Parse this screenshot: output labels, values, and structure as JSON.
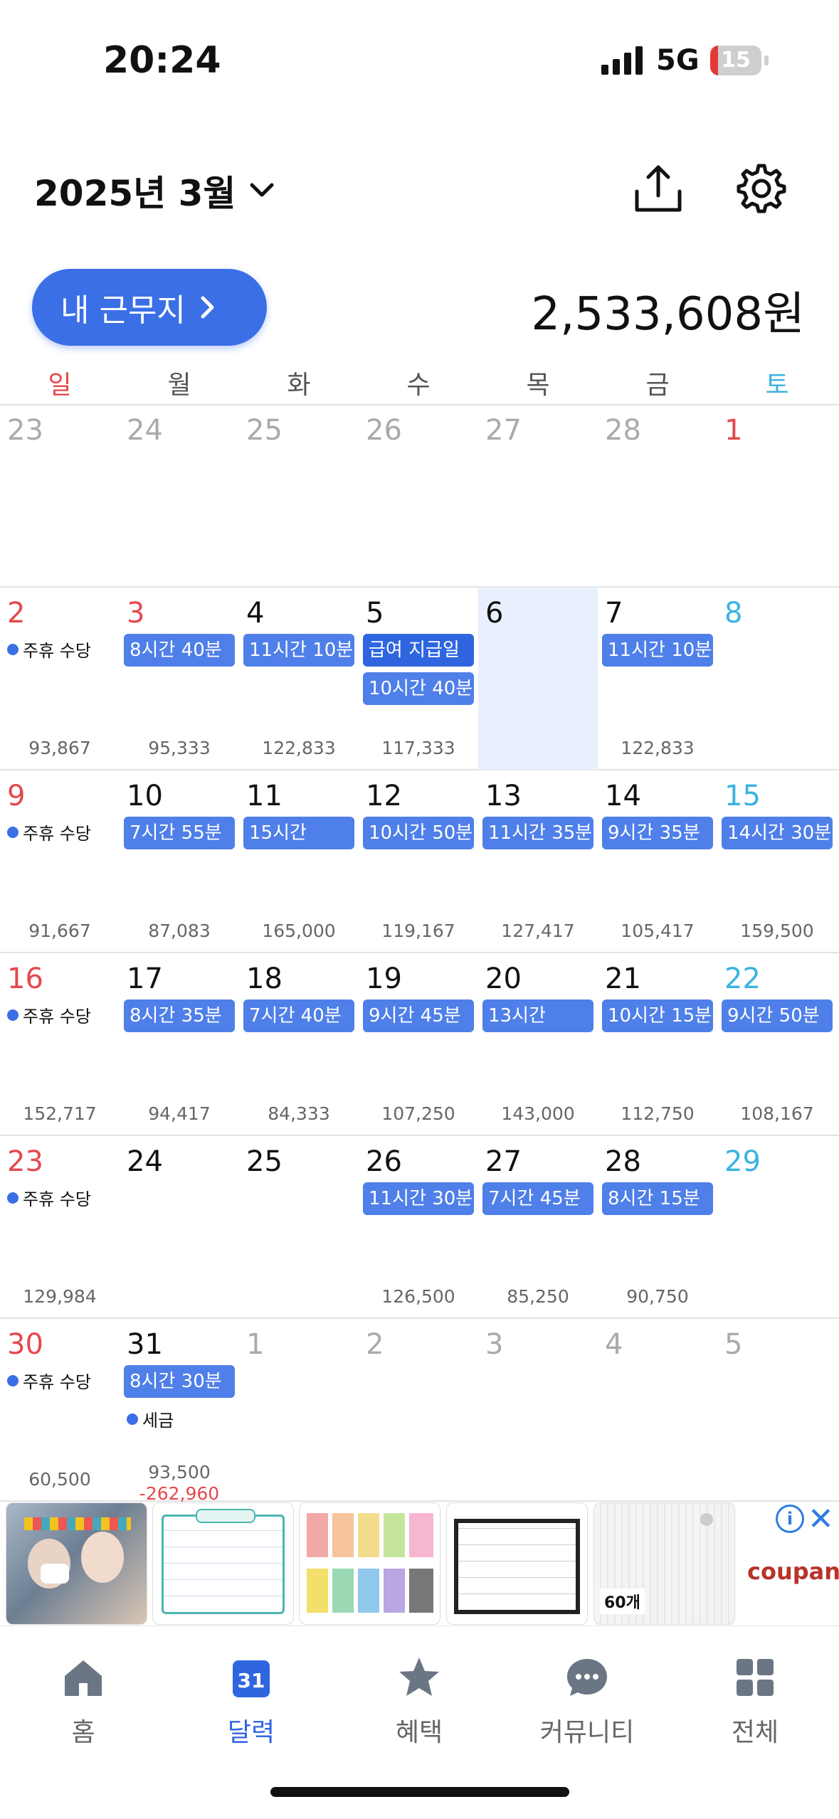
{
  "status_bar": {
    "time": "20:24",
    "network": "5G",
    "battery": "15",
    "battery_level": 0.15
  },
  "header": {
    "month_title": "2025년 3월"
  },
  "workplace": {
    "button_label": "내 근무지",
    "total_amount": "2,533,608원"
  },
  "weekdays": [
    "일",
    "월",
    "화",
    "수",
    "목",
    "금",
    "토"
  ],
  "weeks": [
    [
      {
        "day": "23",
        "kind": "other"
      },
      {
        "day": "24",
        "kind": "other"
      },
      {
        "day": "25",
        "kind": "other"
      },
      {
        "day": "26",
        "kind": "other"
      },
      {
        "day": "27",
        "kind": "other"
      },
      {
        "day": "28",
        "kind": "other"
      },
      {
        "day": "1",
        "kind": "sun"
      }
    ],
    [
      {
        "day": "2",
        "kind": "sun",
        "note": "주휴 수당",
        "amount": "93,867"
      },
      {
        "day": "3",
        "kind": "sun",
        "chips": [
          "8시간 40분"
        ],
        "amount": "95,333"
      },
      {
        "day": "4",
        "chips": [
          "11시간 10분"
        ],
        "amount": "122,833"
      },
      {
        "day": "5",
        "chips": [
          "급여 지급일",
          "10시간 40분"
        ],
        "amount": "117,333"
      },
      {
        "day": "6",
        "today": true
      },
      {
        "day": "7",
        "chips": [
          "11시간 10분"
        ],
        "amount": "122,833"
      },
      {
        "day": "8",
        "kind": "sat"
      }
    ],
    [
      {
        "day": "9",
        "kind": "sun",
        "note": "주휴 수당",
        "amount": "91,667"
      },
      {
        "day": "10",
        "chips": [
          "7시간 55분"
        ],
        "amount": "87,083"
      },
      {
        "day": "11",
        "chips": [
          "15시간"
        ],
        "amount": "165,000"
      },
      {
        "day": "12",
        "chips": [
          "10시간 50분"
        ],
        "amount": "119,167"
      },
      {
        "day": "13",
        "chips": [
          "11시간 35분"
        ],
        "amount": "127,417"
      },
      {
        "day": "14",
        "chips": [
          "9시간 35분"
        ],
        "amount": "105,417"
      },
      {
        "day": "15",
        "kind": "sat",
        "chips": [
          "14시간 30분"
        ],
        "amount": "159,500"
      }
    ],
    [
      {
        "day": "16",
        "kind": "sun",
        "note": "주휴 수당",
        "amount": "152,717"
      },
      {
        "day": "17",
        "chips": [
          "8시간 35분"
        ],
        "amount": "94,417"
      },
      {
        "day": "18",
        "chips": [
          "7시간 40분"
        ],
        "amount": "84,333"
      },
      {
        "day": "19",
        "chips": [
          "9시간 45분"
        ],
        "amount": "107,250"
      },
      {
        "day": "20",
        "chips": [
          "13시간"
        ],
        "amount": "143,000"
      },
      {
        "day": "21",
        "chips": [
          "10시간 15분"
        ],
        "amount": "112,750"
      },
      {
        "day": "22",
        "kind": "sat",
        "chips": [
          "9시간 50분"
        ],
        "amount": "108,167"
      }
    ],
    [
      {
        "day": "23",
        "kind": "sun",
        "note": "주휴 수당",
        "amount": "129,984"
      },
      {
        "day": "24"
      },
      {
        "day": "25"
      },
      {
        "day": "26",
        "chips": [
          "11시간 30분"
        ],
        "amount": "126,500"
      },
      {
        "day": "27",
        "chips": [
          "7시간 45분"
        ],
        "amount": "85,250"
      },
      {
        "day": "28",
        "chips": [
          "8시간 15분"
        ],
        "amount": "90,750"
      },
      {
        "day": "29",
        "kind": "sat"
      }
    ],
    [
      {
        "day": "30",
        "kind": "sun",
        "note": "주휴 수당",
        "amount": "60,500"
      },
      {
        "day": "31",
        "chips": [
          "8시간 30분"
        ],
        "note": "세금",
        "amount": "93,500",
        "amount2": "-262,960"
      },
      {
        "day": "1",
        "kind": "other"
      },
      {
        "day": "2",
        "kind": "other"
      },
      {
        "day": "3",
        "kind": "other"
      },
      {
        "day": "4",
        "kind": "other"
      },
      {
        "day": "5",
        "kind": "other"
      }
    ]
  ],
  "ad": {
    "brand": "coupang",
    "info_icon": "info-icon",
    "close_icon": "close-icon",
    "thumb5_badge": "60개"
  },
  "nav": [
    {
      "label": "홈",
      "icon": "home-icon"
    },
    {
      "label": "달력",
      "icon": "calendar-icon",
      "badge": "31",
      "active": true
    },
    {
      "label": "혜택",
      "icon": "star-icon"
    },
    {
      "label": "커뮤니티",
      "icon": "chat-icon"
    },
    {
      "label": "전체",
      "icon": "grid-icon"
    }
  ],
  "colors": {
    "accent": "#3b6fe6",
    "sunday": "#e5484d",
    "saturday": "#3bb3e0",
    "today_bg": "#e8effd"
  }
}
